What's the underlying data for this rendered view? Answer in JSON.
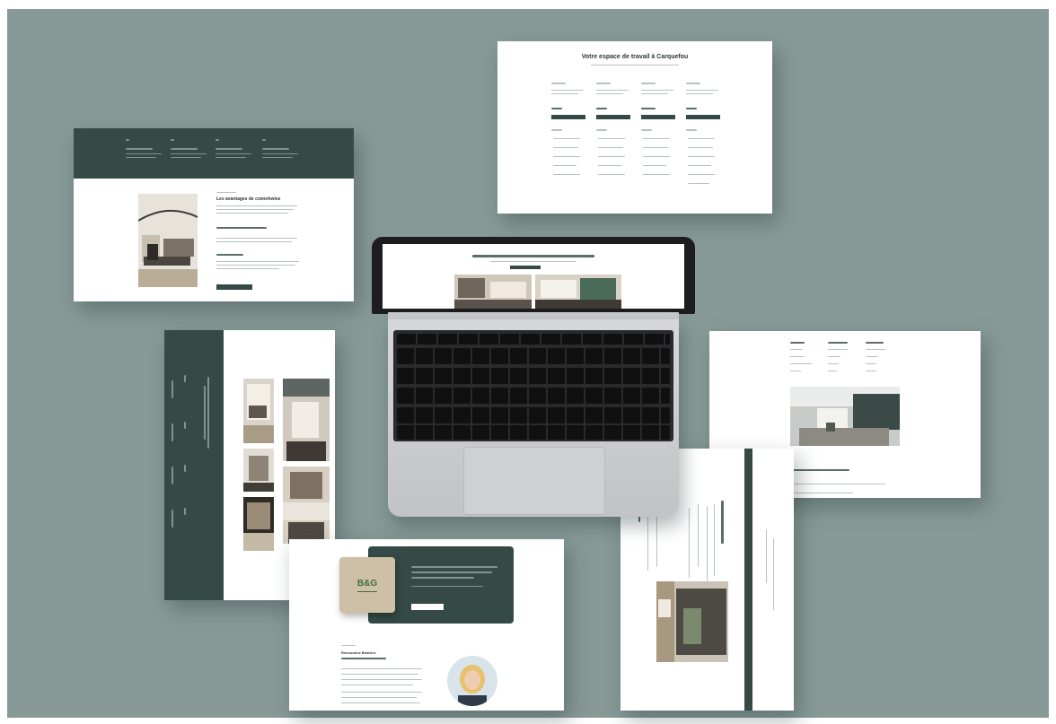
{
  "colors": {
    "backdrop": "#879a98",
    "brand_dark": "#354a46",
    "page_white": "#ffffff",
    "laptop_body": "#c9cacc",
    "keyboard": "#101011"
  },
  "pricing_page": {
    "title": "Votre espace de travail à Carquefou"
  },
  "tiles_page": {
    "title": "Les avantages de coworkwise"
  },
  "logo": {
    "text": "B&G"
  },
  "profile_page": {
    "heading": "Rencontrez Béatrice"
  },
  "icons": [
    "laptop-icon",
    "logo-badge-icon",
    "avatar-icon"
  ]
}
